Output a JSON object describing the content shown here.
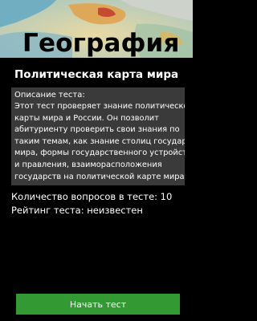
{
  "app": {
    "title": "География"
  },
  "test": {
    "name": "Политическая карта мира",
    "description_label": "Описание теста:",
    "description_lines": [
      "Этот тест проверяет знание политической",
      "карты мира и России. Он позволит",
      "абитуриенту проверить свои знания по",
      "таким темам, как знание столиц государст",
      "мира, формы государственного устройств",
      "и правления, взаиморасположения",
      "государств на политической карте мира."
    ],
    "questions_count_text": "Количество вопросов в тесте: 10",
    "rating_text": "Рейтинг теста: неизвестен"
  },
  "actions": {
    "start_label": "Начать тест"
  },
  "colors": {
    "background": "#000000",
    "description_box": "#3a3a3a",
    "start_button": "#339933",
    "title_text": "#000000",
    "body_text": "#ffffff"
  },
  "icons": {
    "banner": "globe-banner-image"
  }
}
